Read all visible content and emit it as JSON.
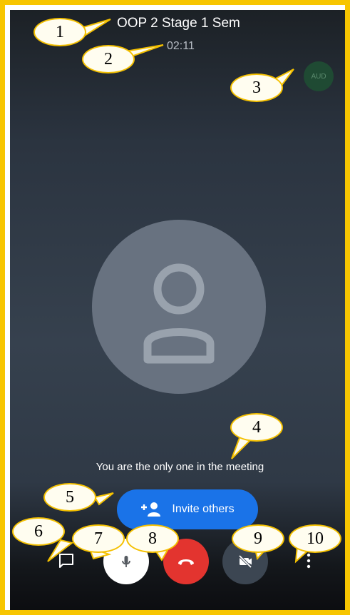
{
  "call": {
    "title": "OOP 2 Stage 1 Sem",
    "duration": "02:11",
    "audio_badge": "AUD"
  },
  "main": {
    "empty_message": "You are the only one in the meeting",
    "invite_label": "Invite others",
    "invite_icon": "person-add-icon",
    "avatar_icon": "person-placeholder-icon"
  },
  "controls": [
    {
      "name": "chat",
      "icon": "chat-icon"
    },
    {
      "name": "mic",
      "icon": "microphone-icon"
    },
    {
      "name": "end-call",
      "icon": "hang-up-icon"
    },
    {
      "name": "camera",
      "icon": "camera-off-icon"
    },
    {
      "name": "more",
      "icon": "more-vert-icon"
    }
  ],
  "annotations": [
    "1",
    "2",
    "3",
    "4",
    "5",
    "6",
    "7",
    "8",
    "9",
    "10"
  ],
  "colors": {
    "frame": "#f7c500",
    "invite": "#1a73e8",
    "end_call": "#e3342f",
    "callout_border": "#f4c000"
  }
}
